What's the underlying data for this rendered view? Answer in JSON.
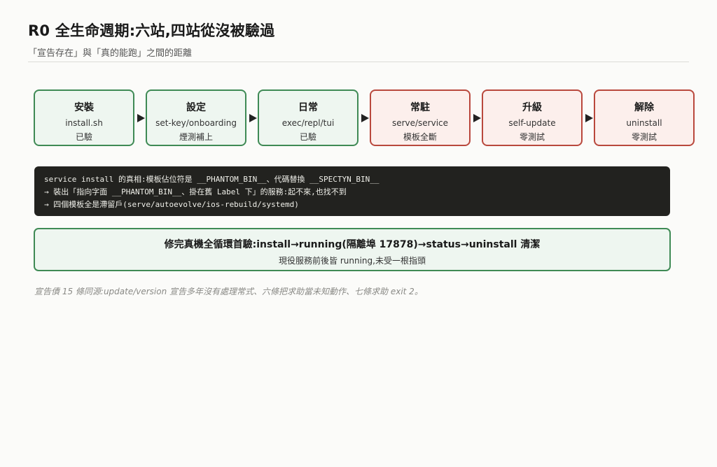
{
  "header": {
    "title": "R0 全生命週期:六站,四站從沒被驗過",
    "subtitle": "「宣告存在」與「真的能跑」之間的距離"
  },
  "stages": [
    {
      "name": "安裝",
      "cmd": "install.sh",
      "status": "已驗",
      "state": "ok"
    },
    {
      "name": "設定",
      "cmd": "set-key/onboarding",
      "status": "煙測補上",
      "state": "ok"
    },
    {
      "name": "日常",
      "cmd": "exec/repl/tui",
      "status": "已驗",
      "state": "ok"
    },
    {
      "name": "常駐",
      "cmd": "serve/service",
      "status": "模板全斷",
      "state": "bad"
    },
    {
      "name": "升級",
      "cmd": "self-update",
      "status": "零測試",
      "state": "bad"
    },
    {
      "name": "解除",
      "cmd": "uninstall",
      "status": "零測試",
      "state": "bad"
    }
  ],
  "code_block": {
    "lines": [
      "service install 的真相:模板佔位符是 __PHANTOM_BIN__、代碼替換 __SPECTYN_BIN__",
      "→ 裝出「指向字面 __PHANTOM_BIN__、掛在舊 Label 下」的服務:起不來,也找不到",
      "→ 四個模板全是滯留戶(serve/autoevolve/ios-rebuild/systemd)"
    ]
  },
  "result": {
    "headline": "修完真機全循環首驗:install→running(隔離埠 17878)→status→uninstall 清潔",
    "sub": "現役服務前後皆 running,未受一根指頭"
  },
  "footnote": "宣告債 15 條同源:update/version 宣告多年沒有處理常式、六條把求助當未知動作、七條求助 exit 2。"
}
